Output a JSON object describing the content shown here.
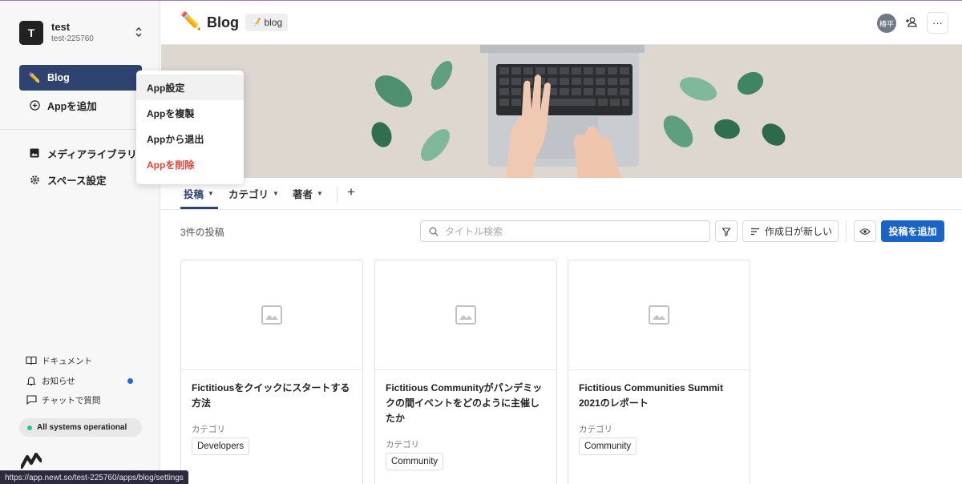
{
  "space": {
    "initial": "T",
    "name": "test",
    "id": "test-225760"
  },
  "sidebar": {
    "apps": [
      {
        "label": "Blog",
        "icon": "pencil-icon",
        "active": true
      }
    ],
    "add_app": "Appを追加",
    "media_library": "メディアライブラリ",
    "space_settings": "スペース設定",
    "footer": {
      "docs": "ドキュメント",
      "news": "お知らせ",
      "chat": "チャットで質問",
      "status": "All systems operational"
    }
  },
  "context_menu": {
    "items": [
      {
        "label": "App設定",
        "highlighted": true
      },
      {
        "label": "Appを複製"
      },
      {
        "label": "Appから退出"
      },
      {
        "label": "Appを削除",
        "danger": true
      }
    ]
  },
  "header": {
    "title": "Blog",
    "uid": "blog",
    "user_avatar": "椿平"
  },
  "tabs": [
    {
      "label": "投稿",
      "active": true
    },
    {
      "label": "カテゴリ"
    },
    {
      "label": "著者"
    }
  ],
  "toolbar": {
    "count": "3件の投稿",
    "search_placeholder": "タイトル検索",
    "sort_label": "作成日が新しい",
    "add_label": "投稿を追加"
  },
  "posts": [
    {
      "title": "Fictitiousをクイックにスタートする方法",
      "category_label": "カテゴリ",
      "category": "Developers"
    },
    {
      "title": "Fictitious Communityがパンデミックの間イベントをどのように主催したか",
      "category_label": "カテゴリ",
      "category": "Community"
    },
    {
      "title": "Fictitious Communities Summit 2021のレポート",
      "category_label": "カテゴリ",
      "category": "Community"
    }
  ],
  "status_url": "https://app.newt.so/test-225760/apps/blog/settings",
  "colors": {
    "accent": "#2f4370",
    "primary_button": "#1a63c7",
    "danger": "#e0433a",
    "status_ok": "#20c997",
    "badge_dot": "#1a6fd6"
  }
}
